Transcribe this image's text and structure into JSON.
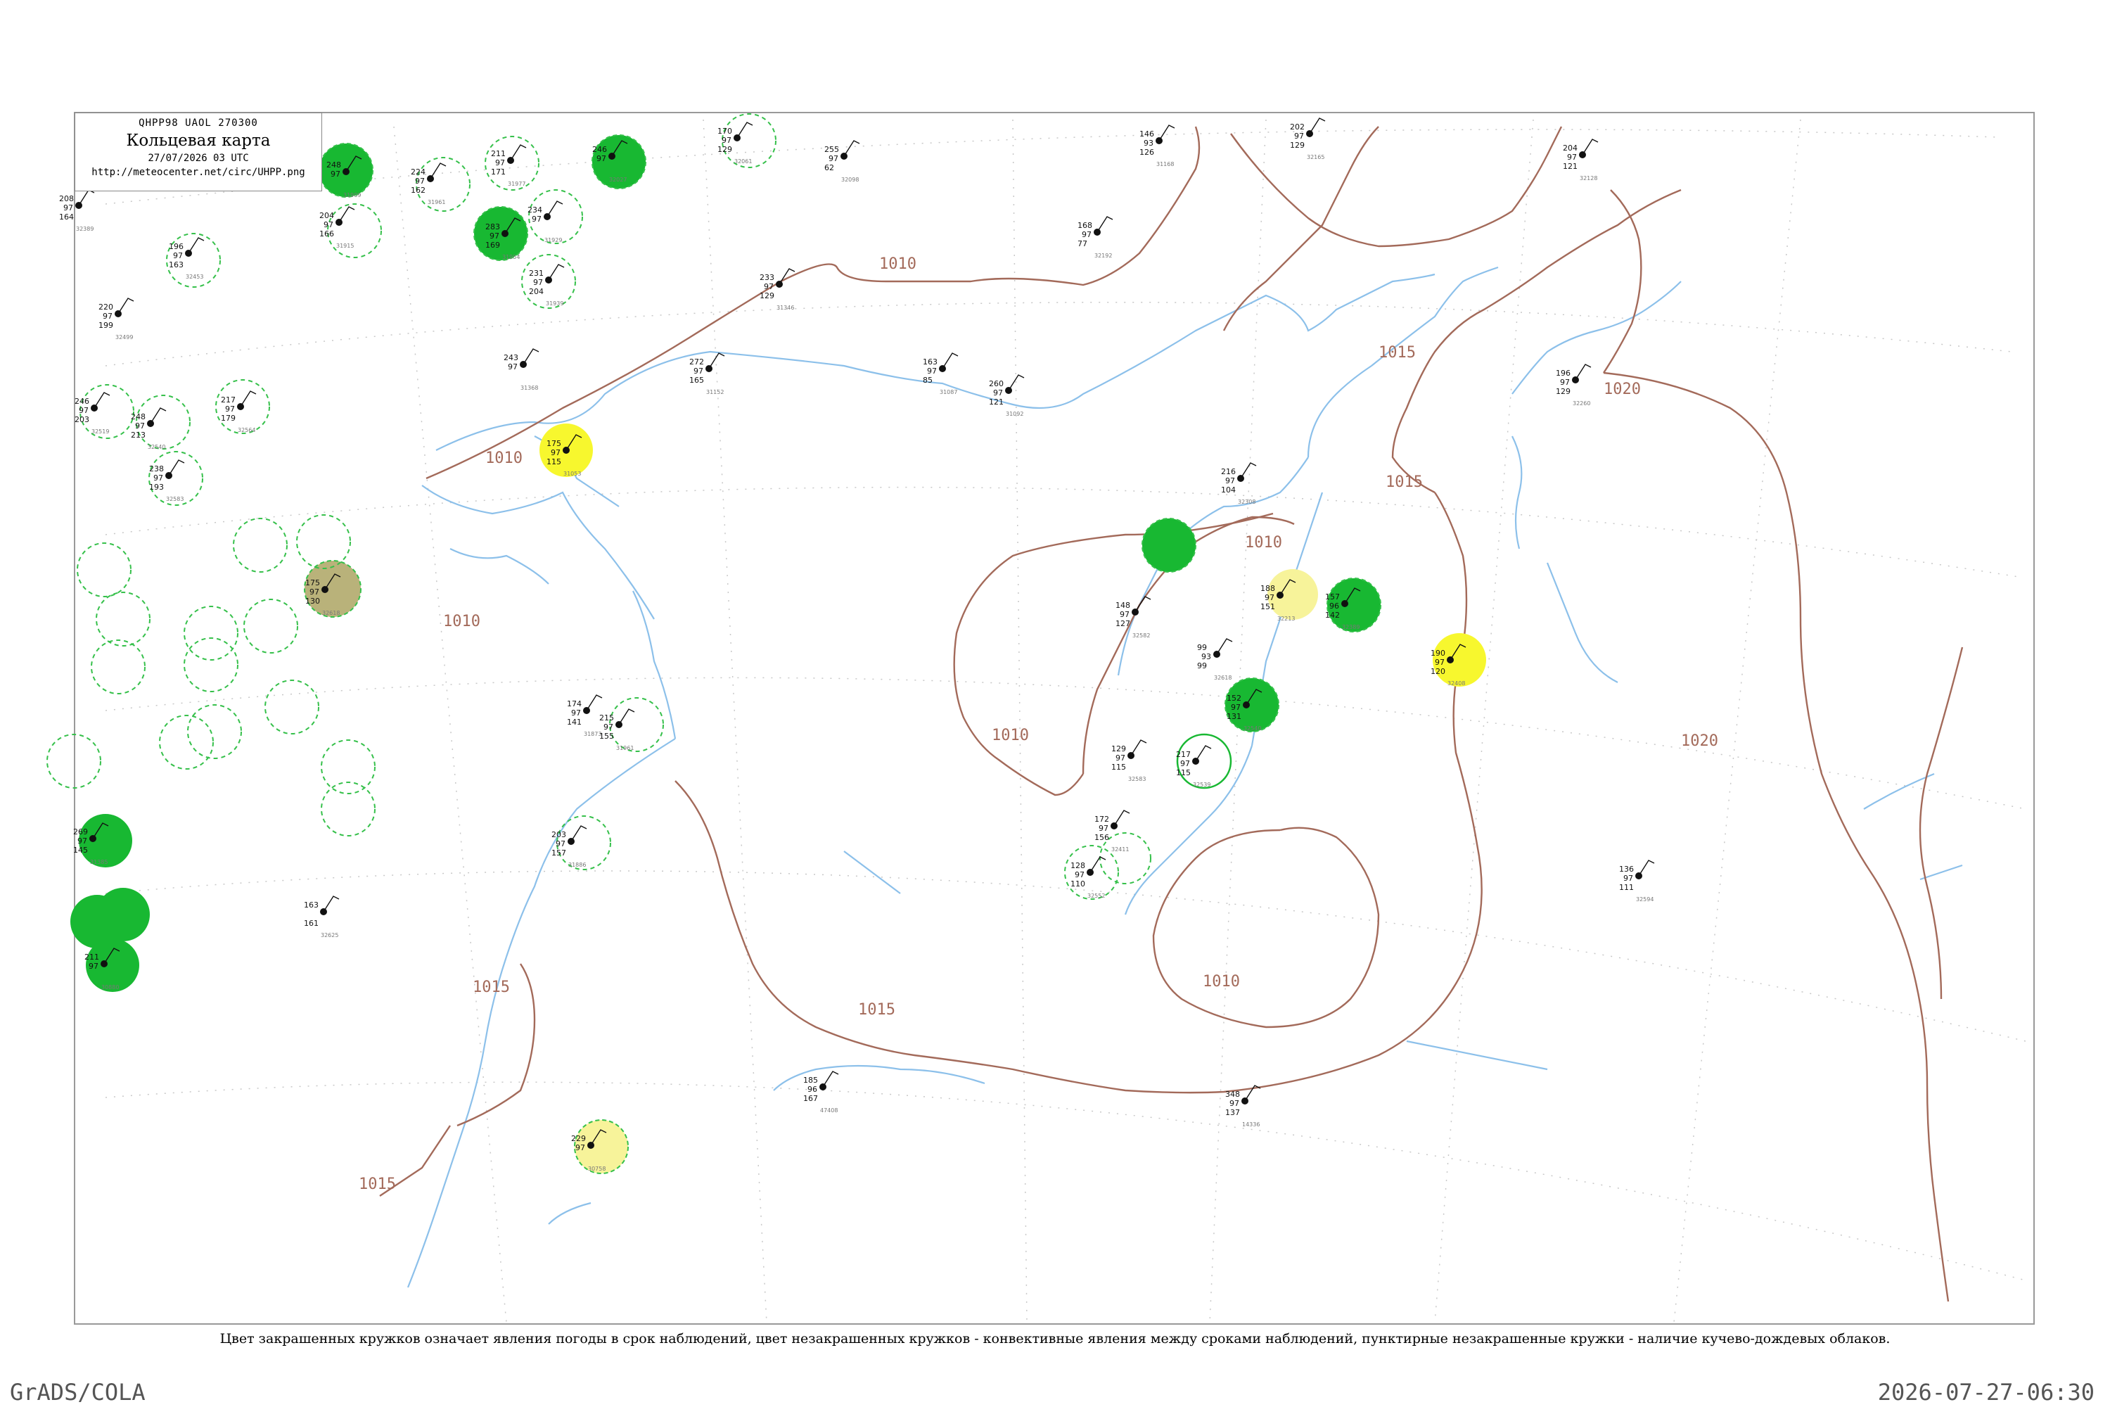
{
  "legend": {
    "code_line": "QHPP98  UAOL  270300",
    "title": "Кольцевая карта",
    "datetime": "27/07/2026 03 UTC",
    "url": "http://meteocenter.net/circ/UHPP.png"
  },
  "caption": "Цвет закрашенных кружков означает явления погоды в срок наблюдений, цвет незакрашенных кружков - конвективные явления между сроками наблюдений, пунктирные незакрашенные кружки - наличие кучево-дождевых облаков.",
  "footer": {
    "left": "GrADS/COLA",
    "right": "2026-07-27-06:30"
  },
  "colors": {
    "isobar": "#a36a5a",
    "coast": "#8cc0ea",
    "storm_fill": "#18b832",
    "rain_fill": "#f7f72e",
    "light_fill": "#f7f39a",
    "haze_fill": "#b9b27a",
    "cb_ring": "#35c04a"
  },
  "isobars": [
    {
      "value": "1010",
      "label_count": 7
    },
    {
      "value": "1015",
      "label_count": 5
    },
    {
      "value": "1020",
      "label_count": 2
    }
  ],
  "stations": [
    {
      "p": "208",
      "t": "97",
      "v": "164",
      "id": "32389",
      "marker": "none"
    },
    {
      "p": "196",
      "t": "97",
      "v": "163",
      "id": "32453",
      "marker": "cb"
    },
    {
      "p": "220",
      "t": "97",
      "v": "199",
      "id": "32499",
      "marker": "none"
    },
    {
      "p": "246",
      "t": "97",
      "v": "203",
      "id": "32519",
      "marker": "cb"
    },
    {
      "p": "248",
      "t": "97",
      "v": "213",
      "id": "32540",
      "marker": "cb"
    },
    {
      "p": "217",
      "t": "97",
      "v": "179",
      "id": "32564",
      "marker": "cb"
    },
    {
      "p": "238",
      "t": "97",
      "v": "193",
      "id": "32583",
      "marker": "cb"
    },
    {
      "p": "224",
      "t": "97",
      "v": "162",
      "id": "31961",
      "marker": "cb"
    },
    {
      "p": "211",
      "t": "97",
      "v": "171",
      "id": "31977",
      "marker": "cb"
    },
    {
      "p": "248",
      "t": "97",
      "v": "",
      "id": "31909",
      "marker": "storm"
    },
    {
      "p": "204",
      "t": "97",
      "v": "166",
      "id": "31915",
      "marker": "cb"
    },
    {
      "p": "234",
      "t": "97",
      "v": "",
      "id": "31929",
      "marker": "storm"
    },
    {
      "p": "231",
      "t": "97",
      "v": "204",
      "id": "31939",
      "marker": "cb"
    },
    {
      "p": "283",
      "t": "97",
      "v": "169",
      "id": "31954",
      "marker": "cb"
    },
    {
      "p": "246",
      "t": "97",
      "v": "",
      "id": "32027",
      "marker": "storm"
    },
    {
      "p": "170",
      "t": "97",
      "v": "129",
      "id": "32061",
      "marker": "cb"
    },
    {
      "p": "255",
      "t": "97",
      "v": "62",
      "id": "32098",
      "marker": "none"
    },
    {
      "p": "233",
      "t": "97",
      "v": "129",
      "id": "31346",
      "marker": "none"
    },
    {
      "p": "243",
      "t": "97",
      "v": "",
      "id": "31368",
      "marker": "none"
    },
    {
      "p": "272",
      "t": "97",
      "v": "165",
      "id": "31152",
      "marker": "none"
    },
    {
      "p": "163",
      "t": "97",
      "v": "85",
      "id": "31087",
      "marker": "none"
    },
    {
      "p": "260",
      "t": "97",
      "v": "121",
      "id": "31092",
      "marker": "none"
    },
    {
      "p": "175",
      "t": "97",
      "v": "115",
      "id": "31053",
      "marker": "none"
    },
    {
      "p": "146",
      "t": "93",
      "v": "126",
      "id": "31168",
      "marker": "rain"
    },
    {
      "p": "202",
      "t": "97",
      "v": "129",
      "id": "32165",
      "marker": "none"
    },
    {
      "p": "204",
      "t": "97",
      "v": "121",
      "id": "32128",
      "marker": "none"
    },
    {
      "p": "168",
      "t": "97",
      "v": "77",
      "id": "32192",
      "marker": "none"
    },
    {
      "p": "196",
      "t": "97",
      "v": "129",
      "id": "32260",
      "marker": "none"
    },
    {
      "p": "216",
      "t": "97",
      "v": "104",
      "id": "32308",
      "marker": "none"
    },
    {
      "p": "188",
      "t": "97",
      "v": "151",
      "id": "32213",
      "marker": "none"
    },
    {
      "p": "157",
      "t": "96",
      "v": "142",
      "id": "32389",
      "marker": "light"
    },
    {
      "p": "190",
      "t": "97",
      "v": "120",
      "id": "32408",
      "marker": "storm"
    },
    {
      "p": "99",
      "t": "93",
      "v": "99",
      "id": "32618",
      "marker": "rain"
    },
    {
      "p": "152",
      "t": "97",
      "v": "131",
      "id": "32540",
      "marker": "none"
    },
    {
      "p": "217",
      "t": "97",
      "v": "115",
      "id": "32539",
      "marker": "storm"
    },
    {
      "p": "129",
      "t": "97",
      "v": "115",
      "id": "32583",
      "marker": "conv"
    },
    {
      "p": "148",
      "t": "97",
      "v": "127",
      "id": "32582",
      "marker": "none"
    },
    {
      "p": "172",
      "t": "97",
      "v": "156",
      "id": "32411",
      "marker": "none"
    },
    {
      "p": "128",
      "t": "97",
      "v": "110",
      "id": "32552",
      "marker": "none"
    },
    {
      "p": "136",
      "t": "97",
      "v": "111",
      "id": "32594",
      "marker": "cb"
    },
    {
      "p": "175",
      "t": "97",
      "v": "130",
      "id": "32618",
      "marker": "none"
    },
    {
      "p": "269",
      "t": "97",
      "v": "145",
      "id": "31385",
      "marker": "haze"
    },
    {
      "p": "211",
      "t": "97",
      "v": "",
      "id": "30880",
      "marker": "storm"
    },
    {
      "p": "229",
      "t": "97",
      "v": "",
      "id": "30758",
      "marker": "storm"
    },
    {
      "p": "185",
      "t": "96",
      "v": "167",
      "id": "47408",
      "marker": "rain"
    },
    {
      "p": "348",
      "t": "97",
      "v": "137",
      "id": "14336",
      "marker": "none"
    },
    {
      "p": "163",
      "t": "",
      "v": "161",
      "id": "32625",
      "marker": "none"
    },
    {
      "p": "203",
      "t": "97",
      "v": "157",
      "id": "31886",
      "marker": "none"
    },
    {
      "p": "174",
      "t": "97",
      "v": "141",
      "id": "31873",
      "marker": "cb"
    },
    {
      "p": "215",
      "t": "97",
      "v": "155",
      "id": "31961",
      "marker": "none"
    },
    {
      "p": "238",
      "t": "97",
      "v": "98",
      "id": "31888",
      "marker": "cb"
    }
  ]
}
